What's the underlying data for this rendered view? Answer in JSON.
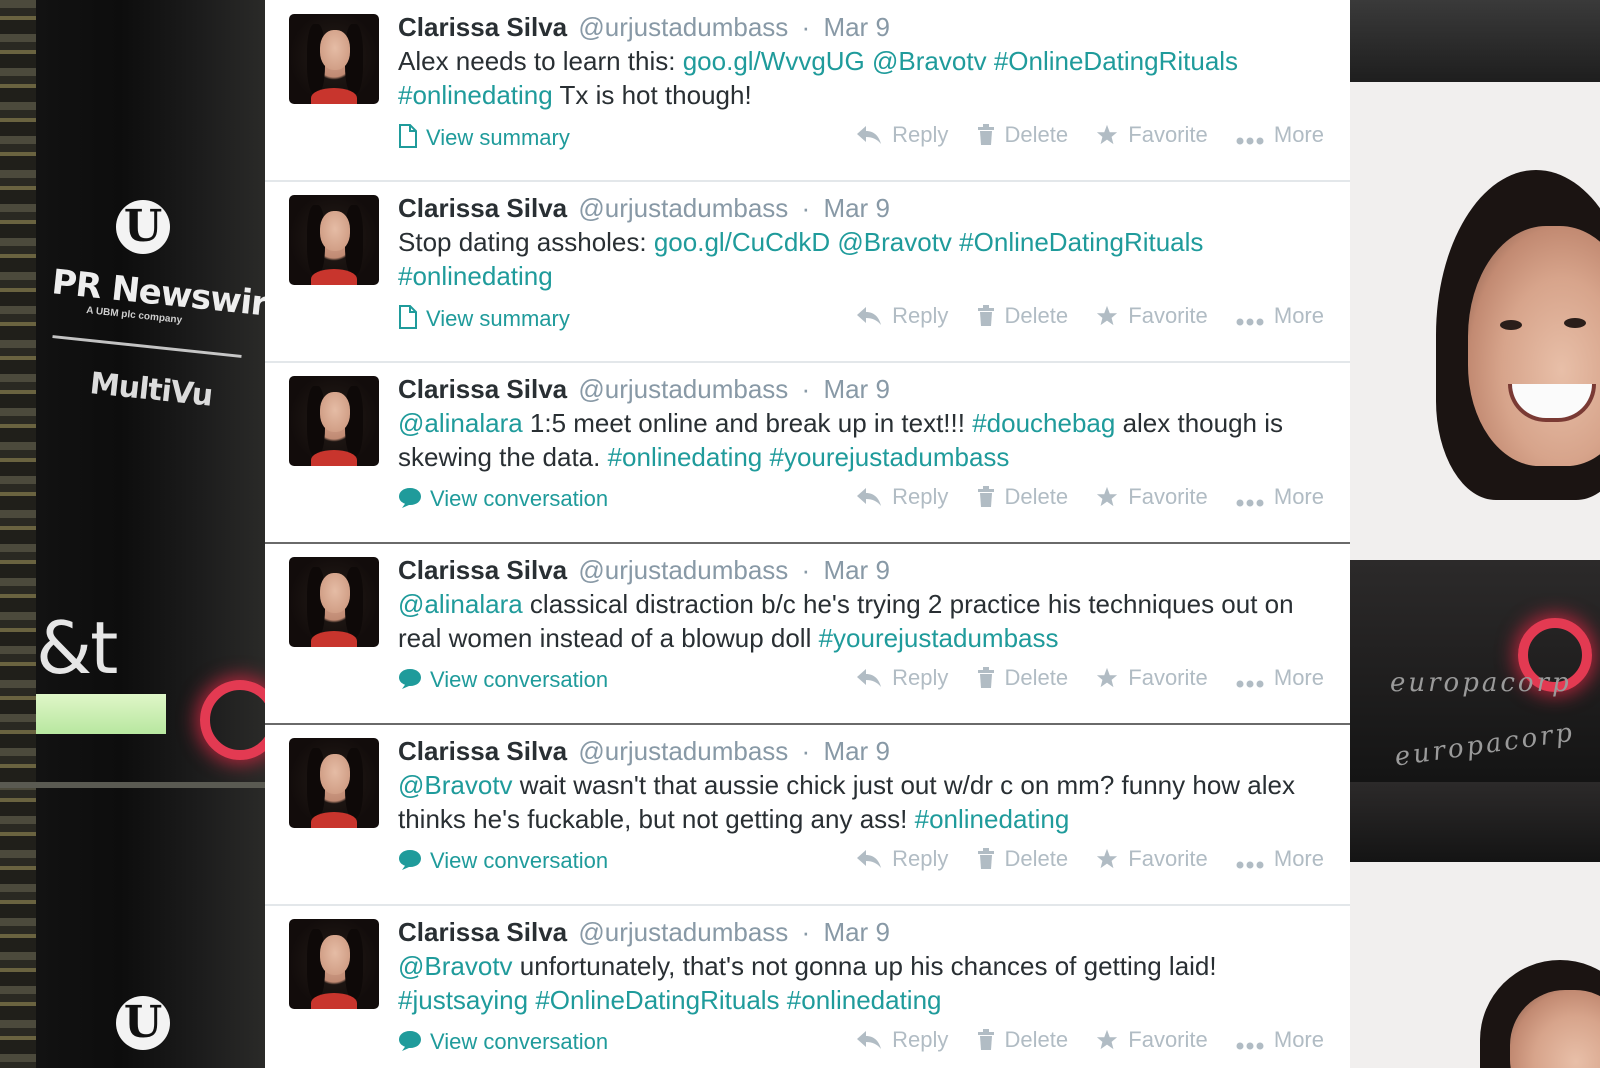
{
  "background": {
    "left_sign_texts": [
      "PR Newswire",
      "A UBM plc company",
      "MultiVu",
      "&t"
    ],
    "right_sign_texts": [
      "europacorp",
      "europacorp"
    ]
  },
  "timeline": {
    "action_labels": {
      "reply": "Reply",
      "delete": "Delete",
      "favorite": "Favorite",
      "more": "More"
    },
    "tweets": [
      {
        "name": "Clarissa Silva",
        "handle": "@urjustadumbass",
        "separator": "·",
        "date": "Mar 9",
        "line1": [
          {
            "t": "Alex needs to learn this: ",
            "link": false
          },
          {
            "t": "goo.gl/WvvgUG",
            "link": true
          },
          {
            "t": " ",
            "link": false
          },
          {
            "t": "@Bravotv",
            "link": true
          },
          {
            "t": " ",
            "link": false
          },
          {
            "t": "#OnlineDatingRituals",
            "link": true
          }
        ],
        "line2": [
          {
            "t": "#onlinedating",
            "link": true
          },
          {
            "t": " Tx is hot though!",
            "link": false
          }
        ],
        "expand_label": "View summary",
        "expand_icon": "document-icon"
      },
      {
        "name": "Clarissa Silva",
        "handle": "@urjustadumbass",
        "separator": "·",
        "date": "Mar 9",
        "line1": [
          {
            "t": "Stop dating assholes: ",
            "link": false
          },
          {
            "t": "goo.gl/CuCdkD",
            "link": true
          },
          {
            "t": " ",
            "link": false
          },
          {
            "t": "@Bravotv",
            "link": true
          },
          {
            "t": " ",
            "link": false
          },
          {
            "t": "#OnlineDatingRituals",
            "link": true
          }
        ],
        "line2": [
          {
            "t": "#onlinedating",
            "link": true
          }
        ],
        "expand_label": "View summary",
        "expand_icon": "document-icon"
      },
      {
        "name": "Clarissa Silva",
        "handle": "@urjustadumbass",
        "separator": "·",
        "date": "Mar 9",
        "line1": [
          {
            "t": "@alinalara",
            "link": true
          },
          {
            "t": " 1:5 meet online and break up in text!!! ",
            "link": false
          },
          {
            "t": "#douchebag",
            "link": true
          },
          {
            "t": " alex though is",
            "link": false
          }
        ],
        "line2": [
          {
            "t": "skewing the data. ",
            "link": false
          },
          {
            "t": "#onlinedating",
            "link": true
          },
          {
            "t": " ",
            "link": false
          },
          {
            "t": "#yourejustadumbass",
            "link": true
          }
        ],
        "expand_label": "View conversation",
        "expand_icon": "speech-bubble-icon"
      },
      {
        "name": "Clarissa Silva",
        "handle": "@urjustadumbass",
        "separator": "·",
        "date": "Mar 9",
        "line1": [
          {
            "t": "@alinalara",
            "link": true
          },
          {
            "t": " classical distraction b/c he's trying 2 practice his techniques out on",
            "link": false
          }
        ],
        "line2": [
          {
            "t": "real women instead of a blowup doll ",
            "link": false
          },
          {
            "t": "#yourejustadumbass",
            "link": true
          }
        ],
        "expand_label": "View conversation",
        "expand_icon": "speech-bubble-icon"
      },
      {
        "name": "Clarissa Silva",
        "handle": "@urjustadumbass",
        "separator": "·",
        "date": "Mar 9",
        "line1": [
          {
            "t": "@Bravotv",
            "link": true
          },
          {
            "t": " wait wasn't that aussie chick just out w/dr c on mm? funny how alex",
            "link": false
          }
        ],
        "line2": [
          {
            "t": "thinks he's fuckable, but not getting any ass! ",
            "link": false
          },
          {
            "t": "#onlinedating",
            "link": true
          }
        ],
        "expand_label": "View conversation",
        "expand_icon": "speech-bubble-icon"
      },
      {
        "name": "Clarissa Silva",
        "handle": "@urjustadumbass",
        "separator": "·",
        "date": "Mar 9",
        "line1": [
          {
            "t": "@Bravotv",
            "link": true
          },
          {
            "t": "  unfortunately, that's not gonna up his chances of getting laid!",
            "link": false
          }
        ],
        "line2": [
          {
            "t": "#justsaying",
            "link": true
          },
          {
            "t": " ",
            "link": false
          },
          {
            "t": "#OnlineDatingRituals",
            "link": true
          },
          {
            "t": " ",
            "link": false
          },
          {
            "t": "#onlinedating",
            "link": true
          }
        ],
        "expand_label": "View conversation",
        "expand_icon": "speech-bubble-icon"
      }
    ]
  }
}
